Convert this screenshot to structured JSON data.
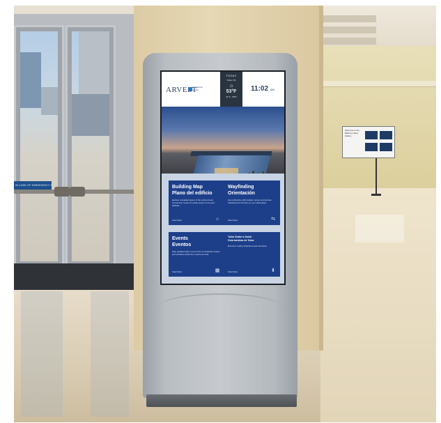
{
  "kiosk": {
    "header": {
      "logo_text": "ARVEST",
      "logo_sub": "Convention Center",
      "time": "11:02",
      "time_suffix": "AM"
    },
    "weather": {
      "day_label": "TODAY",
      "location": "Tulsa, OK",
      "condition_icon": "sun-icon",
      "temperature": "53°F",
      "low": "41°F",
      "high": "58°F"
    },
    "tiles": [
      {
        "title": "Building Map",
        "subtitle": "Plano del edificio",
        "description": "Explore a detailed layout of the entire Arvest Convention Center to easily locate rooms and facilities.",
        "more": "View More",
        "icon": "map-icon"
      },
      {
        "title": "Wayfinding",
        "subtitle": "Orientación",
        "description": "Get a directory with location names and arrows indicating the direction to your destination.",
        "more": "View More",
        "icon": "signpost-icon"
      },
      {
        "title": "Events",
        "subtitle": "Eventos",
        "description": "Stay updated with a current list of scheduled events and activities within the conference hall.",
        "more": "View More",
        "icon": "calendar-icon"
      },
      {
        "title": "Tulsa Visitor's Guide",
        "subtitle": "Guía turística de Tulsa",
        "description": "Discover nearby attractions and amenities.",
        "more": "View More",
        "icon": "pin-icon"
      }
    ]
  },
  "door_sign": "IN CASE OF EMERGENCY PUSH BAR",
  "wall_sign": {
    "text": "Welcome to the Ballroom East Gallery"
  },
  "colors": {
    "tile_blue": "#1d3f8a",
    "kiosk_silver": "#c6cacf",
    "brand_navy": "#2a3f66"
  }
}
